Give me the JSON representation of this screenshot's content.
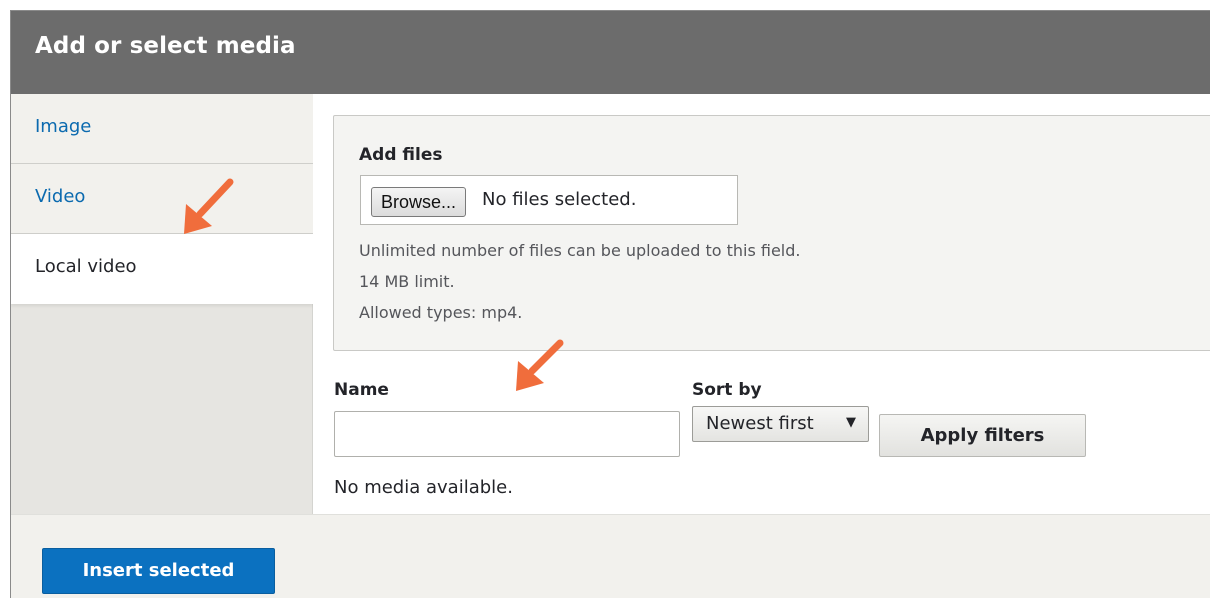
{
  "dialog": {
    "title": "Add or select media"
  },
  "sidebar": {
    "tabs": [
      {
        "label": "Image",
        "active": false
      },
      {
        "label": "Video",
        "active": false
      },
      {
        "label": "Local video",
        "active": true
      }
    ]
  },
  "upload": {
    "label": "Add files",
    "browse_label": "Browse...",
    "status": "No files selected.",
    "descriptions": [
      "Unlimited number of files can be uploaded to this field.",
      "14 MB limit.",
      "Allowed types: mp4."
    ]
  },
  "filters": {
    "name_label": "Name",
    "name_value": "",
    "sort_label": "Sort by",
    "sort_value": "Newest first",
    "apply_label": "Apply filters"
  },
  "results": {
    "empty_text": "No media available."
  },
  "footer": {
    "insert_label": "Insert selected"
  },
  "colors": {
    "titlebar": "#6c6c6c",
    "link": "#0b6aaf",
    "primary": "#0b71c0",
    "annotation_arrow": "#f06d3c"
  },
  "icons": [
    "caret-down-icon",
    "annotation-arrow-icon"
  ]
}
